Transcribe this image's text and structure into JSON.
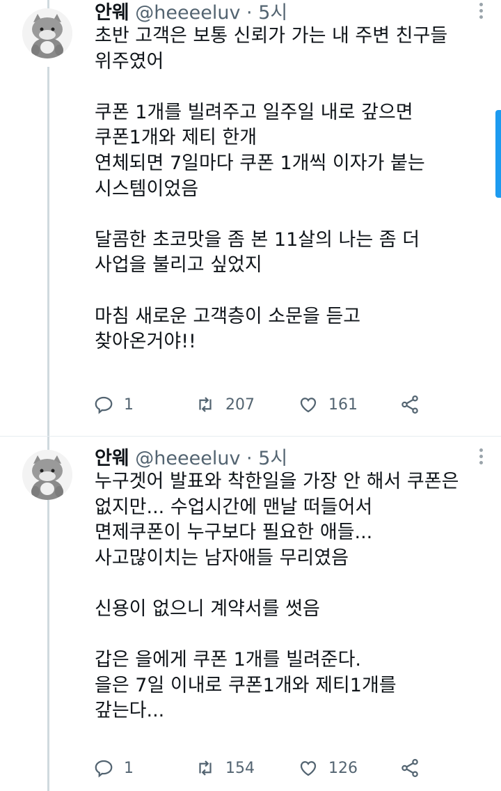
{
  "tweets": [
    {
      "name": "안웨",
      "handle": "@heeeeluv",
      "separator": "·",
      "time": "5시",
      "lines": [
        "초반 고객은 보통 신뢰가 가는 내 주변 친구들",
        "위주였어",
        "",
        "쿠폰 1개를 빌려주고 일주일 내로 갚으면",
        "쿠폰1개와 제티 한개",
        "연체되면 7일마다 쿠폰 1개씩 이자가 붙는",
        "시스템이었음",
        "",
        "달콤한 초코맛을 좀 본 11살의 나는 좀 더",
        "사업을 불리고 싶었지",
        "",
        "마침 새로운 고객층이 소문을 듣고",
        "찾아온거야!!"
      ],
      "reply_count": "1",
      "retweet_count": "207",
      "like_count": "161"
    },
    {
      "name": "안웨",
      "handle": "@heeeeluv",
      "separator": "·",
      "time": "5시",
      "lines": [
        "누구겟어 발표와 착한일을 가장 안 해서 쿠폰은",
        "없지만... 수업시간에 맨날 떠들어서",
        "면제쿠폰이 누구보다 필요한 애들...",
        "사고많이치는 남자애들 무리였음",
        "",
        "신용이 없으니 계약서를 썻음",
        "",
        "갑은 을에게 쿠폰 1개를 빌려준다.",
        "을은 7일 이내로 쿠폰1개와 제티1개를",
        "갚는다..."
      ],
      "reply_count": "1",
      "retweet_count": "154",
      "like_count": "126"
    }
  ],
  "icons": {
    "reply": "reply-icon",
    "retweet": "retweet-icon",
    "like": "heart-icon",
    "share": "share-icon",
    "more": "more-icon"
  },
  "colors": {
    "accent": "#1d9bf0",
    "text": "#0f1419",
    "secondary": "#536471",
    "thread_line": "#cfd9de"
  }
}
